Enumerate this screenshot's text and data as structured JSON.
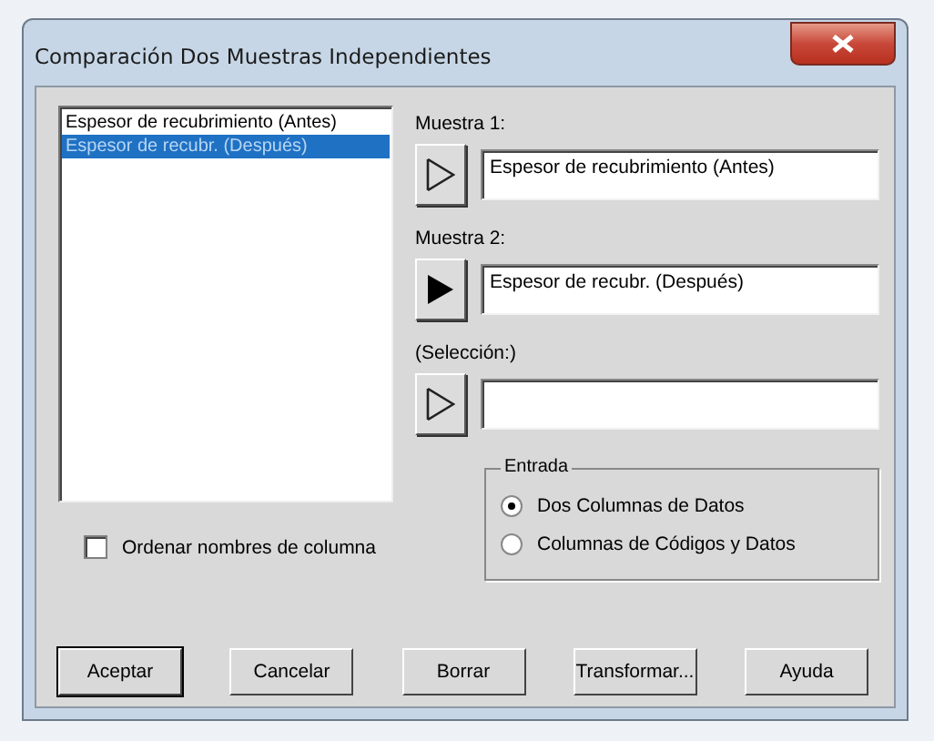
{
  "window": {
    "title": "Comparación Dos Muestras Independientes"
  },
  "listbox": {
    "items": [
      {
        "label": "Espesor de recubrimiento (Antes)",
        "selected": false
      },
      {
        "label": "Espesor de recubr. (Después)",
        "selected": true
      }
    ]
  },
  "targets": [
    {
      "label": "Muestra 1:",
      "value": "Espesor de recubrimiento (Antes)",
      "active": false
    },
    {
      "label": "Muestra 2:",
      "value": "Espesor de recubr. (Después)",
      "active": true
    },
    {
      "label": "(Selección:)",
      "active": false
    }
  ],
  "sort_checkbox": {
    "label": "Ordenar nombres de columna",
    "checked": false
  },
  "input_group": {
    "title": "Entrada",
    "options": [
      {
        "label": "Dos Columnas de Datos",
        "selected": true
      },
      {
        "label": "Columnas de Códigos y Datos",
        "selected": false
      }
    ]
  },
  "buttons": [
    {
      "label": "Aceptar",
      "default": true
    },
    {
      "label": "Cancelar",
      "default": false
    },
    {
      "label": "Borrar",
      "default": false
    },
    {
      "label": "Transformar...",
      "default": false
    },
    {
      "label": "Ayuda",
      "default": false
    }
  ]
}
